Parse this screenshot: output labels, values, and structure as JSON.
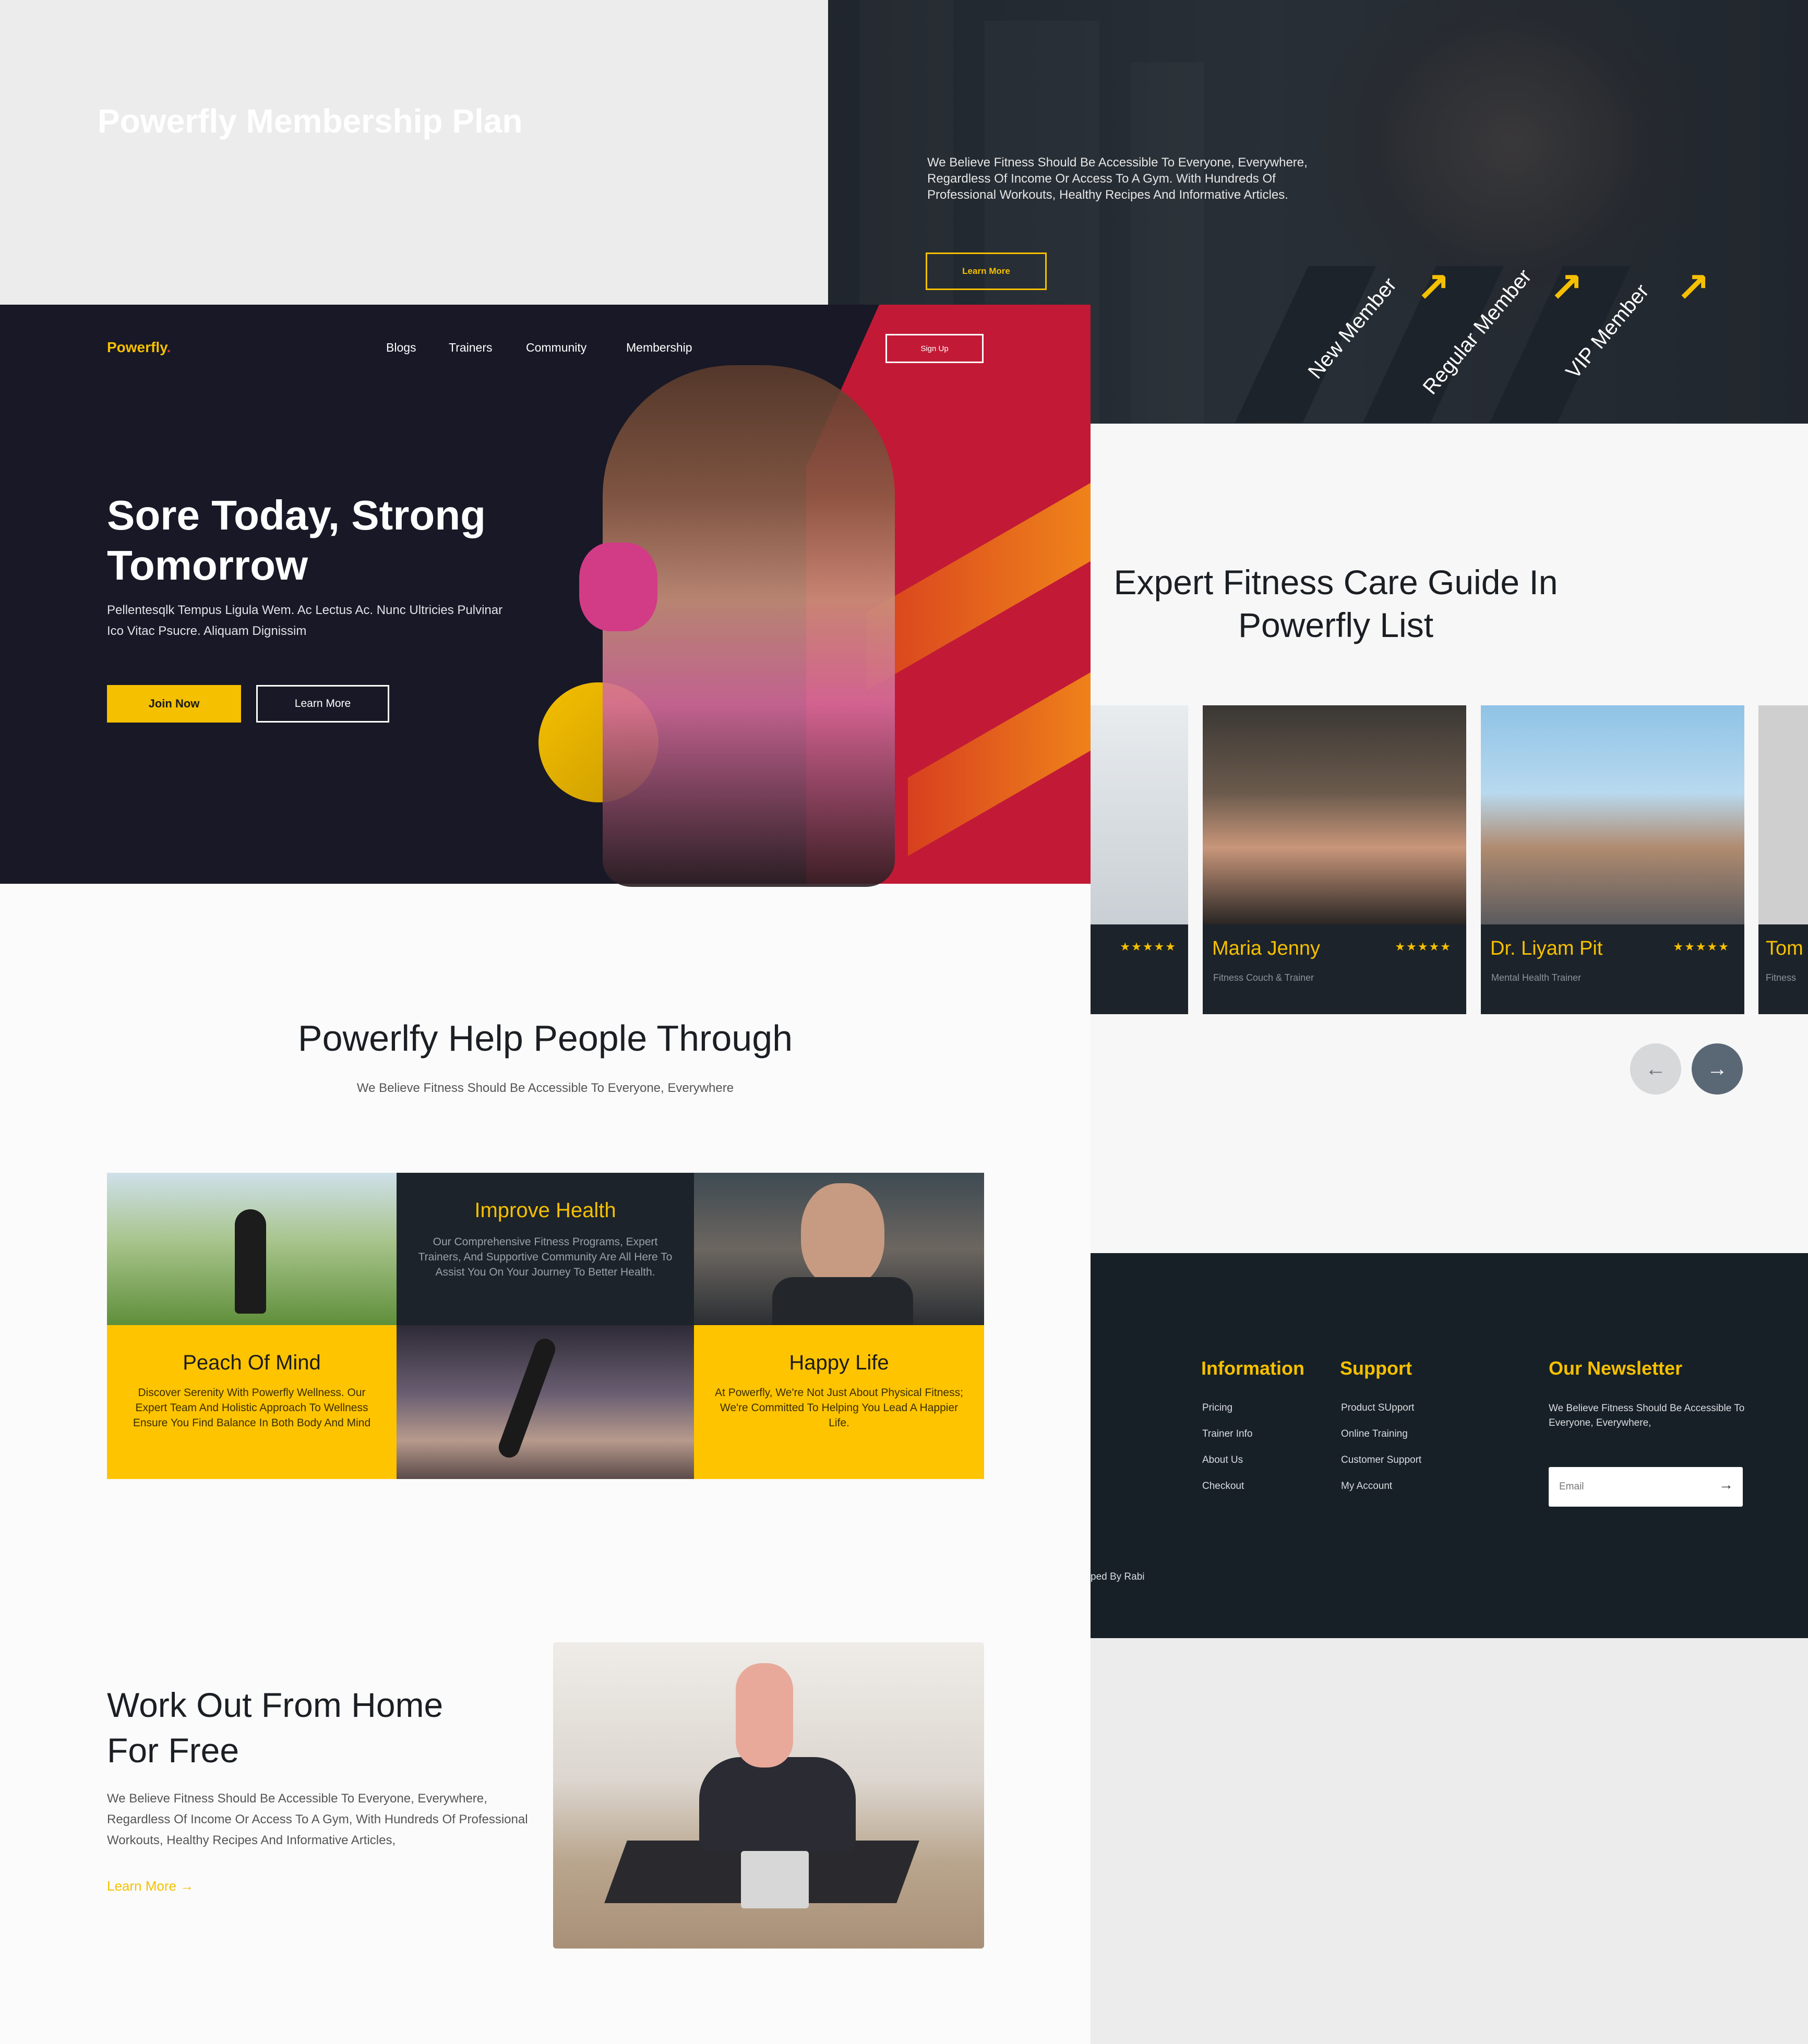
{
  "membership": {
    "title": "Powerfly Membership Plan",
    "description": "We Believe Fitness Should Be Accessible To Everyone, Everywhere, Regardless Of Income Or Access To A Gym. With Hundreds Of Professional Workouts, Healthy Recipes And Informative Articles.",
    "learn_more": "Learn More",
    "plans": [
      "New Member",
      "Regular Member",
      "VIP Member"
    ],
    "arrow_icon": "arrow-up-right-icon"
  },
  "header": {
    "logo": "Powerfly",
    "logo_dot": ".",
    "nav": [
      "Blogs",
      "Trainers",
      "Community",
      "Membership"
    ],
    "signup": "Sign Up"
  },
  "hero": {
    "title": "Sore Today, Strong Tomorrow",
    "description": "Pellentesqlk Tempus Ligula Wem. Ac Lectus Ac. Nunc Ultricies Pulvinar Ico Vitac Psucre. Aliquam Dignissim",
    "join": "Join Now",
    "learn_more": "Learn More"
  },
  "help": {
    "title": "Powerlfy Help People Through",
    "subtitle": "We Believe Fitness Should Be Accessible To Everyone, Everywhere",
    "improve": {
      "title": "Improve Health",
      "text": "Our Comprehensive Fitness Programs, Expert Trainers, And Supportive Community Are All Here To Assist You On Your Journey To Better Health."
    },
    "peace": {
      "title": "Peach Of Mind",
      "text": "Discover Serenity With Powerfly Wellness. Our Expert Team And Holistic Approach To Wellness Ensure You Find Balance In Both Body And Mind"
    },
    "happy": {
      "title": "Happy Life",
      "text": "At Powerfly, We're Not Just About Physical Fitness; We're Committed To Helping You Lead A Happier Life."
    }
  },
  "workout": {
    "title": "Work Out From Home For Free",
    "description": "We Believe Fitness Should Be Accessible To Everyone, Everywhere, Regardless Of Income Or Access To A Gym, With Hundreds Of Professional Workouts, Healthy Recipes And Informative Articles,",
    "link": "Learn More",
    "link_arrow": "→"
  },
  "experts": {
    "title": "Expert Fitness Care Guide In Powerfly List",
    "stars": "★★★★★",
    "trainers": [
      {
        "name": "Maria Jenny",
        "role": "Fitness Couch & Trainer",
        "rating": 5
      },
      {
        "name": "Dr. Liyam Pit",
        "role": "Mental Health Trainer",
        "rating": 5
      },
      {
        "name": "Tom",
        "role": "Fitness",
        "rating": 5
      }
    ],
    "prev": "←",
    "next": "→"
  },
  "footer": {
    "information": {
      "heading": "Information",
      "links": [
        "Pricing",
        "Trainer Info",
        "About Us",
        "Checkout"
      ]
    },
    "support": {
      "heading": "Support",
      "links": [
        "Product SUpport",
        "Online Training",
        "Customer Support",
        "My Account"
      ]
    },
    "newsletter": {
      "heading": "Our Newsletter",
      "text": "We Believe Fitness Should Be Accessible To Everyone, Everywhere,",
      "placeholder": "Email",
      "submit": "→"
    },
    "credit": "ped By Rabi"
  },
  "colors": {
    "accent": "#f5c000",
    "dark": "#181826",
    "red": "#c21a36",
    "panel": "#1d232a"
  }
}
